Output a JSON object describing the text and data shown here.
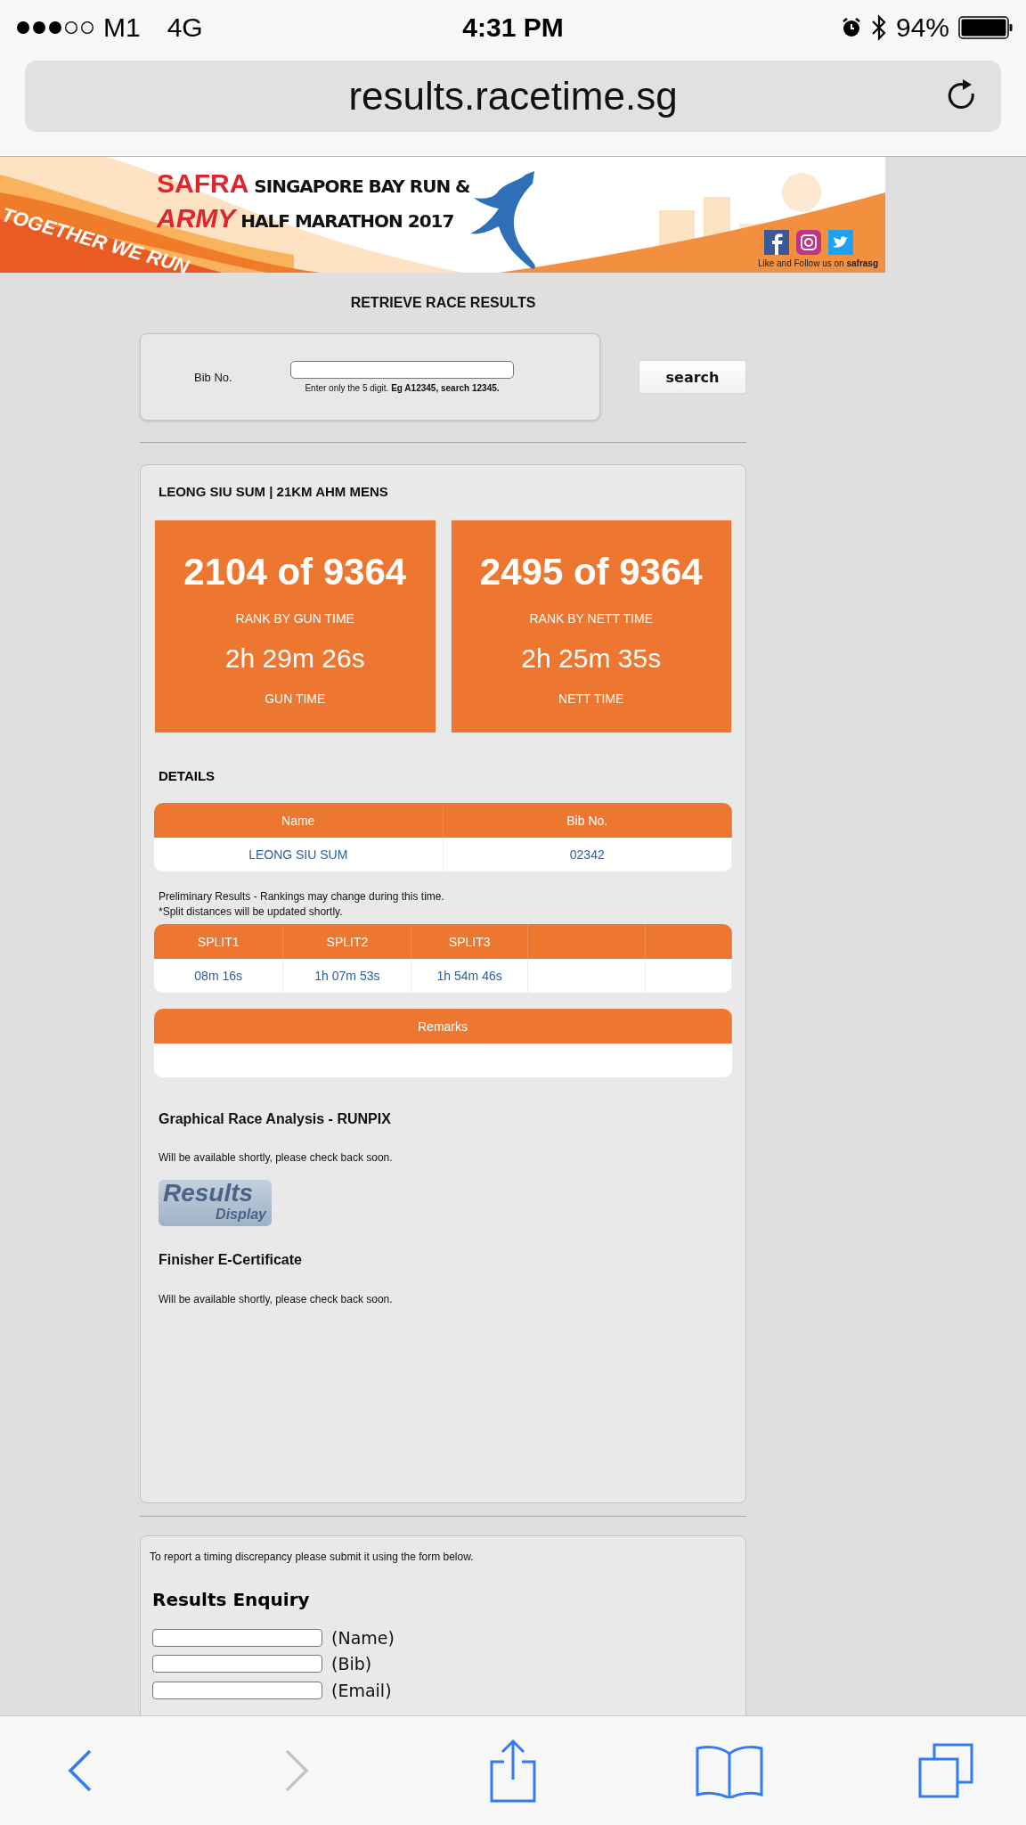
{
  "status_bar": {
    "carrier": "M1",
    "network": "4G",
    "time": "4:31 PM",
    "battery": "94%"
  },
  "address_bar": {
    "url": "results.racetime.sg"
  },
  "banner": {
    "brand_1": "SAFRA",
    "title_1": "SINGAPORE BAY RUN &",
    "brand_2": "ARMY",
    "title_2": "HALF MARATHON 2017",
    "slogan": "TOGETHER WE RUN",
    "follow_text": "Like and Follow us on **safrasg**"
  },
  "page_title": "RETRIEVE RACE RESULTS",
  "search": {
    "label": "Bib No.",
    "hint": "Enter only the 5 digit. **Eg A12345, search 12345.**",
    "button": "search"
  },
  "result": {
    "title": "LEONG SIU SUM | 21KM AHM MENS",
    "ranks": [
      {
        "rank": "2104 of 9364",
        "rank_label": "RANK BY GUN TIME",
        "time": "2h 29m 26s",
        "time_label": "GUN TIME"
      },
      {
        "rank": "2495 of 9364",
        "rank_label": "RANK BY NETT TIME",
        "time": "2h 25m 35s",
        "time_label": "NETT TIME"
      }
    ],
    "details_heading": "DETAILS",
    "details_table": {
      "columns": [
        "Name",
        "Bib No."
      ],
      "rows": [
        [
          "LEONG SIU SUM",
          "02342"
        ]
      ]
    },
    "notes": [
      "Preliminary Results - Rankings may change during this time.",
      "*Split distances will be updated shortly."
    ],
    "splits_table": {
      "columns": [
        "SPLIT1",
        "SPLIT2",
        "SPLIT3"
      ],
      "rows": [
        [
          "08m 16s",
          "1h 07m 53s",
          "1h 54m 46s"
        ]
      ]
    },
    "remarks_table": {
      "columns": [
        "Remarks"
      ]
    },
    "sections": [
      {
        "heading": "Graphical Race Analysis - RUNPIX",
        "text": "Will be available shortly, please check back soon.",
        "logo": [
          "Results",
          "Display"
        ]
      },
      {
        "heading": "Finisher E-Certificate",
        "text": "Will be available shortly, please check back soon."
      }
    ]
  },
  "enquiry": {
    "intro": "To report a timing discrepancy please submit it using the form below.",
    "heading": "Results Enquiry",
    "fields": [
      {
        "label": "(Name)"
      },
      {
        "label": "(Bib)"
      },
      {
        "label": "(Email)"
      }
    ]
  },
  "toolbar": [
    {
      "kind": "back",
      "disabled": false
    },
    {
      "kind": "forward",
      "disabled": true
    },
    {
      "kind": "share",
      "disabled": false
    },
    {
      "kind": "bookmarks",
      "disabled": false
    },
    {
      "kind": "tabs",
      "disabled": false
    }
  ]
}
